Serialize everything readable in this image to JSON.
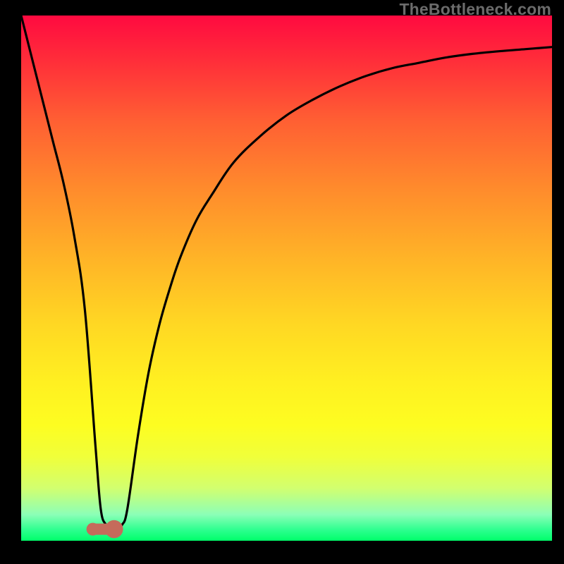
{
  "watermark": "TheBottleneck.com",
  "colors": {
    "frame": "#000000",
    "curve": "#000000",
    "marker_fill": "#c56b5b",
    "gradient_top": "#ff0a40",
    "gradient_bottom": "#00ff6a"
  },
  "chart_data": {
    "type": "line",
    "title": "",
    "xlabel": "",
    "ylabel": "",
    "xlim": [
      0,
      100
    ],
    "ylim": [
      0,
      100
    ],
    "grid": false,
    "legend": false,
    "series": [
      {
        "name": "bottleneck-curve",
        "x": [
          0,
          2,
          4,
          6,
          8,
          10,
          12,
          14,
          15,
          16,
          17,
          18,
          19,
          20,
          22,
          24,
          26,
          28,
          30,
          33,
          36,
          40,
          45,
          50,
          55,
          60,
          65,
          70,
          75,
          80,
          85,
          90,
          95,
          100
        ],
        "y": [
          100,
          92,
          84,
          76,
          68,
          58,
          44,
          18,
          6,
          3,
          2,
          2,
          3,
          6,
          20,
          32,
          41,
          48,
          54,
          61,
          66,
          72,
          77,
          81,
          84,
          86.5,
          88.5,
          90,
          91,
          92,
          92.7,
          93.2,
          93.6,
          94
        ]
      }
    ],
    "markers": [
      {
        "name": "point-a",
        "x": 13.5,
        "y": 2.2,
        "r": 1.2
      },
      {
        "name": "point-b",
        "x": 17.5,
        "y": 2.2,
        "r": 1.7
      }
    ],
    "notch_segment": {
      "x0": 13.5,
      "y0": 2.2,
      "x1": 17.5,
      "y1": 2.2
    }
  }
}
